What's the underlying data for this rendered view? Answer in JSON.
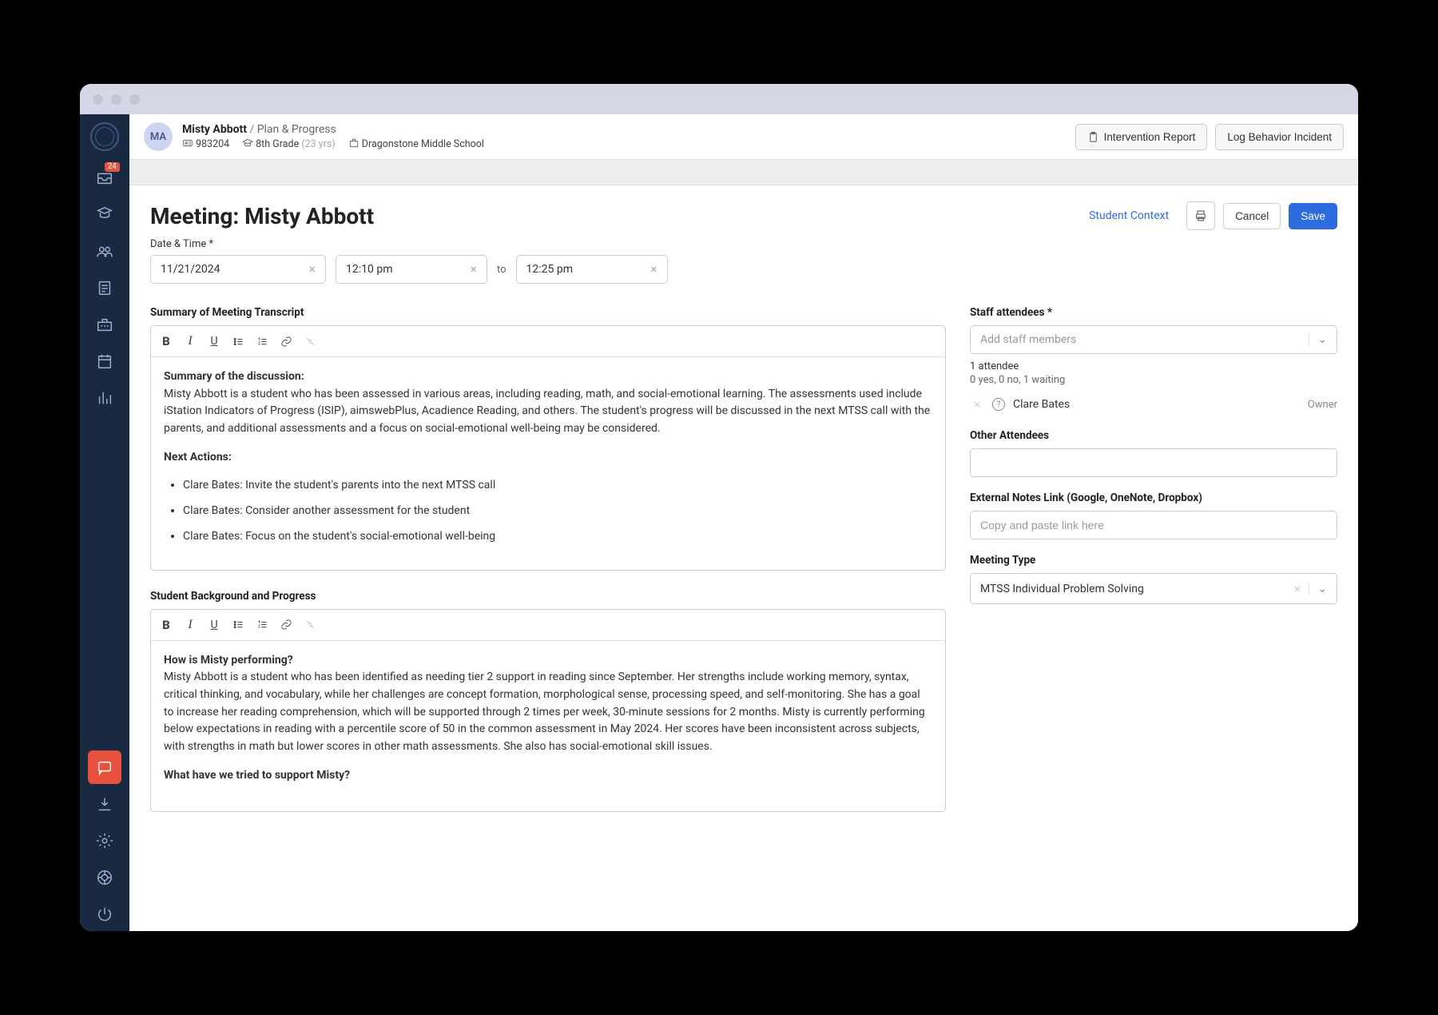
{
  "header": {
    "avatar_initials": "MA",
    "student_name": "Misty Abbott",
    "breadcrumb_section": "Plan & Progress",
    "student_id": "983204",
    "grade": "8th Grade",
    "age": "(23 yrs)",
    "school": "Dragonstone Middle School",
    "intervention_btn": "Intervention Report",
    "log_behavior_btn": "Log Behavior Incident"
  },
  "sidebar": {
    "inbox_badge": "24"
  },
  "page": {
    "title": "Meeting: Misty Abbott",
    "student_context": "Student Context",
    "cancel": "Cancel",
    "save": "Save"
  },
  "datetime": {
    "label": "Date & Time *",
    "date": "11/21/2024",
    "start": "12:10 pm",
    "to": "to",
    "end": "12:25 pm"
  },
  "transcript": {
    "label": "Summary of Meeting Transcript",
    "summary_heading": "Summary of the discussion:",
    "summary_body": "Misty Abbott is a student who has been assessed in various areas, including reading, math, and social-emotional learning. The assessments used include iStation Indicators of Progress (ISIP), aimswebPlus, Acadience Reading, and others. The student's progress will be discussed in the next MTSS call with the parents, and additional assessments and a focus on social-emotional well-being may be considered.",
    "next_actions_heading": "Next Actions:",
    "actions": [
      "Clare Bates: Invite the student's parents into the next MTSS call",
      "Clare Bates: Consider another assessment for the student",
      "Clare Bates: Focus on the student's social-emotional well-being"
    ]
  },
  "background": {
    "label": "Student Background and Progress",
    "q1": "How is Misty performing?",
    "a1": "Misty Abbott is a student who has been identified as needing tier 2 support in reading since September. Her strengths include working memory, syntax, critical thinking, and vocabulary, while her challenges are concept formation, morphological sense, processing speed, and self-monitoring. She has a goal to increase her reading comprehension, which will be supported through 2 times per week, 30-minute sessions for 2 months. Misty is currently performing below expectations in reading with a percentile score of 50 in the common assessment in May 2024. Her scores have been inconsistent across subjects, with strengths in math but lower scores in other math assessments. She also has social-emotional skill issues.",
    "q2": "What have we tried to support Misty?"
  },
  "attendees": {
    "label": "Staff attendees *",
    "placeholder": "Add staff members",
    "count": "1 attendee",
    "status": "0 yes, 0 no, 1 waiting",
    "list": [
      {
        "name": "Clare Bates",
        "role": "Owner"
      }
    ],
    "other_label": "Other Attendees"
  },
  "external_notes": {
    "label": "External Notes Link (Google, OneNote, Dropbox)",
    "placeholder": "Copy and paste link here"
  },
  "meeting_type": {
    "label": "Meeting Type",
    "value": "MTSS Individual Problem Solving"
  }
}
